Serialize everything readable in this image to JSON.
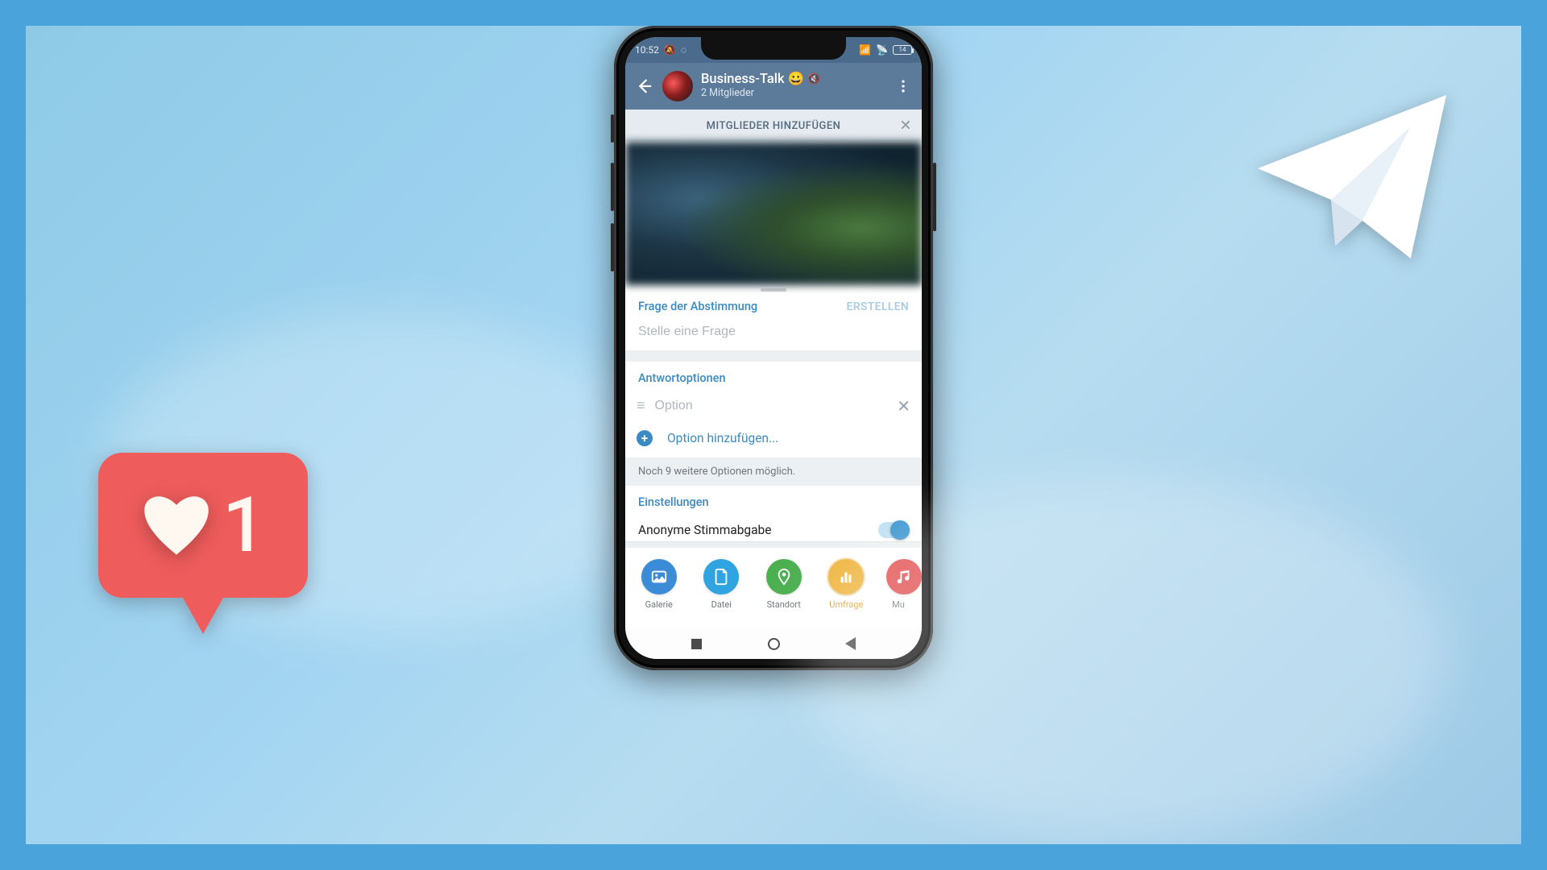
{
  "statusbar": {
    "time": "10:52",
    "battery": "14"
  },
  "header": {
    "title": "Business-Talk",
    "emoji": "😀",
    "mute_icon": "🔇",
    "subtitle": "2 Mitglieder"
  },
  "banner": {
    "text": "MITGLIEDER HINZUFÜGEN"
  },
  "poll": {
    "section_question": "Frage der Abstimmung",
    "create_label": "ERSTELLEN",
    "question_placeholder": "Stelle eine Frage",
    "section_answers": "Antwortoptionen",
    "option_placeholder": "Option",
    "add_option_label": "Option hinzufügen...",
    "remaining_hint": "Noch 9 weitere Optionen möglich.",
    "section_settings": "Einstellungen",
    "anonymous_label": "Anonyme Stimmabgabe",
    "anonymous_on": true
  },
  "dock": {
    "items": [
      {
        "key": "gallery",
        "label": "Galerie",
        "color": "#3b8bd6"
      },
      {
        "key": "file",
        "label": "Datei",
        "color": "#2fa4e0"
      },
      {
        "key": "location",
        "label": "Standort",
        "color": "#4cb050"
      },
      {
        "key": "poll",
        "label": "Umfrage",
        "color": "#efb43c",
        "active": true
      },
      {
        "key": "music",
        "label": "Mu",
        "color": "#e14b4b",
        "cut": true
      }
    ]
  },
  "like_bubble": {
    "count": "1"
  }
}
